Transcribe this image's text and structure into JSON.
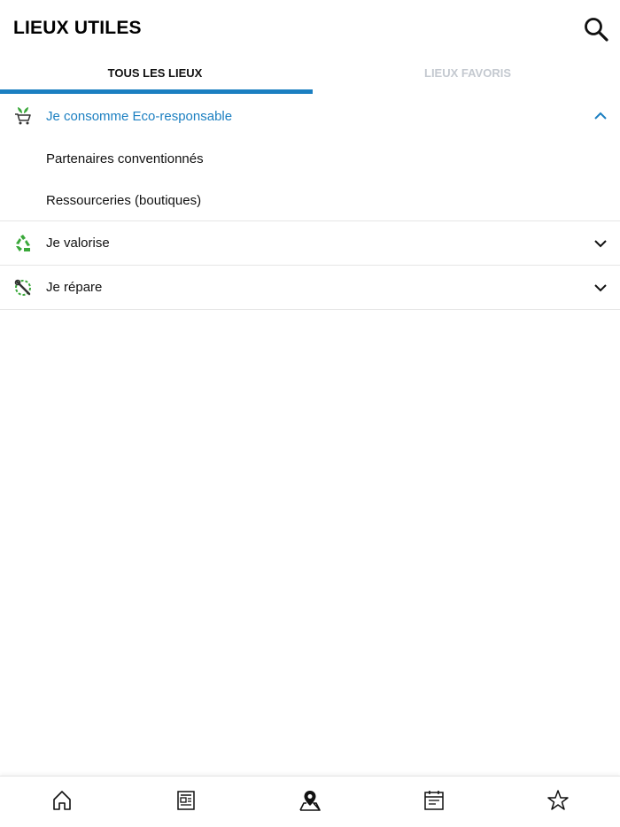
{
  "header": {
    "title": "LIEUX UTILES"
  },
  "tabs": [
    {
      "label": "TOUS LES LIEUX",
      "active": true
    },
    {
      "label": "LIEUX FAVORIS",
      "active": false
    }
  ],
  "categories": [
    {
      "label": "Je consomme Eco-responsable",
      "icon": "eco-cart-icon",
      "expanded": true,
      "items": [
        {
          "label": "Partenaires conventionnés"
        },
        {
          "label": "Ressourceries (boutiques)"
        }
      ]
    },
    {
      "label": "Je valorise",
      "icon": "recycle-icon",
      "expanded": false
    },
    {
      "label": "Je répare",
      "icon": "repair-wrench-icon",
      "expanded": false
    }
  ],
  "bottom_nav": [
    {
      "icon": "home-icon"
    },
    {
      "icon": "news-icon"
    },
    {
      "icon": "map-pin-icon",
      "active": true
    },
    {
      "icon": "calendar-icon"
    },
    {
      "icon": "star-icon"
    }
  ],
  "colors": {
    "accent": "#1b7fc1",
    "icon_green": "#3aa83a",
    "inactive_tab": "#c4c9d0"
  }
}
